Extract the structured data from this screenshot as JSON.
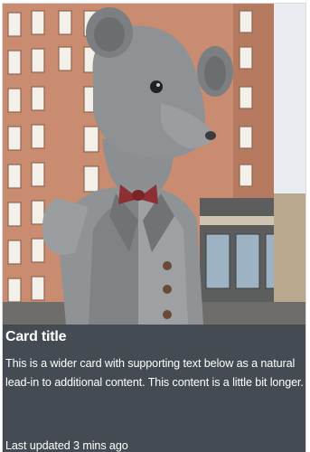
{
  "card": {
    "image_subject": "bronze mouse statue in front of brick building",
    "title": "Card title",
    "text": "This is a wider card with supporting text below as a natural lead-in to additional content. This content is a little bit longer.",
    "footer": "Last updated 3 mins ago"
  },
  "colors": {
    "card_background": "#444b52",
    "text": "#ffffff"
  }
}
